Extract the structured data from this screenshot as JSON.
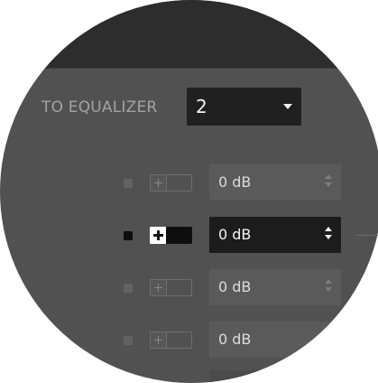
{
  "header": {
    "label": "TO EQUALIZER",
    "dropdown": {
      "value": "2",
      "icon": "chevron-down-icon"
    }
  },
  "gain_rows": [
    {
      "value": "0 dB",
      "active": false
    },
    {
      "value": "0 dB",
      "active": true
    },
    {
      "value": "0 dB",
      "active": false
    },
    {
      "value": "0 dB",
      "active": false
    }
  ],
  "colors": {
    "panel_bg": "#515151",
    "topbar_bg": "#2d2d2d",
    "active_field_bg": "#1c1c1c",
    "text_light": "#f3f3f3",
    "text_muted": "#a3a3a3"
  }
}
